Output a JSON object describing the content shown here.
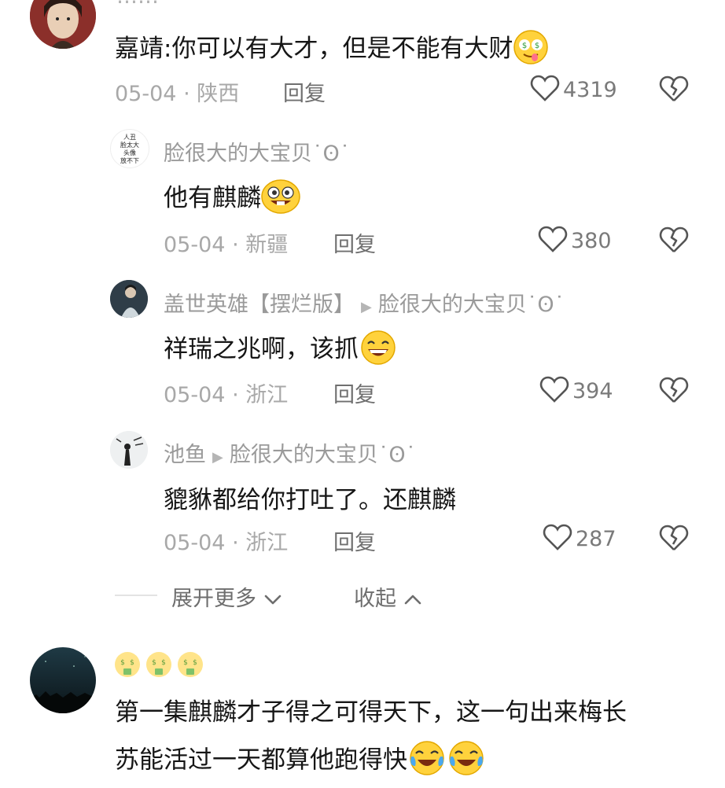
{
  "top_comment": {
    "header_cut": "……",
    "text": "嘉靖:你可以有大才，但是不能有大财",
    "date": "05-04",
    "location": "陕西",
    "reply_label": "回复",
    "likes": "4319"
  },
  "replies": [
    {
      "nickname": "脸很大的大宝贝˙ʘ˙",
      "avatar_text": "人丑\n脸太大\n头像\n放不下",
      "text": "他有麒麟",
      "date": "05-04",
      "location": "新疆",
      "reply_label": "回复",
      "likes": "380"
    },
    {
      "nickname": "盖世英雄【摆烂版】",
      "reply_to": "脸很大的大宝贝˙ʘ˙",
      "text": "祥瑞之兆啊，该抓",
      "date": "05-04",
      "location": "浙江",
      "reply_label": "回复",
      "likes": "394"
    },
    {
      "nickname": "池鱼",
      "reply_to": "脸很大的大宝贝˙ʘ˙",
      "text": "貔貅都给你打吐了。还麒麟",
      "date": "05-04",
      "location": "浙江",
      "reply_label": "回复",
      "likes": "287"
    }
  ],
  "controls": {
    "expand_more": "展开更多",
    "collapse": "收起"
  },
  "second_comment": {
    "line1": "第一集麒麟才子得之可得天下，这一句出来梅长",
    "line2": "苏能活过一天都算他跑得快"
  },
  "colors": {
    "text": "#161616",
    "muted": "#9a9a9a",
    "icon": "#555555"
  }
}
